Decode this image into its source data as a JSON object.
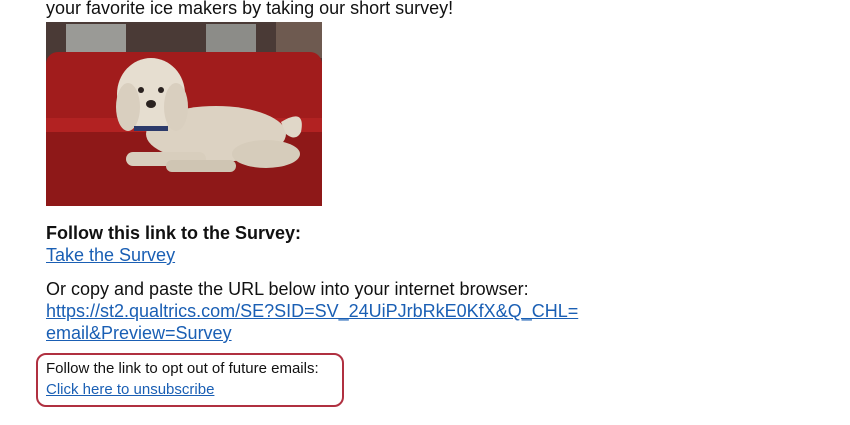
{
  "email": {
    "intro": "your favorite ice makers by taking our short survey!",
    "image": {
      "subject": "white poodle dog lying on red couch"
    },
    "survey_heading": "Follow this link to the Survey:",
    "survey_link_label": "Take the Survey",
    "copy_instructions": "Or copy and paste the URL below into your internet browser:",
    "survey_url_lines": [
      "https://st2.qualtrics.com/SE?SID=SV_24UiPJrbRkE0KfX&Q_CHL=",
      "email&Preview=Survey"
    ],
    "optout_text": "Follow the link to opt out of future emails:",
    "unsubscribe_label": "Click here to unsubscribe"
  },
  "colors": {
    "link": "#1a5fb4",
    "highlight_border": "#b03040",
    "couch": "#8a1a1a"
  }
}
